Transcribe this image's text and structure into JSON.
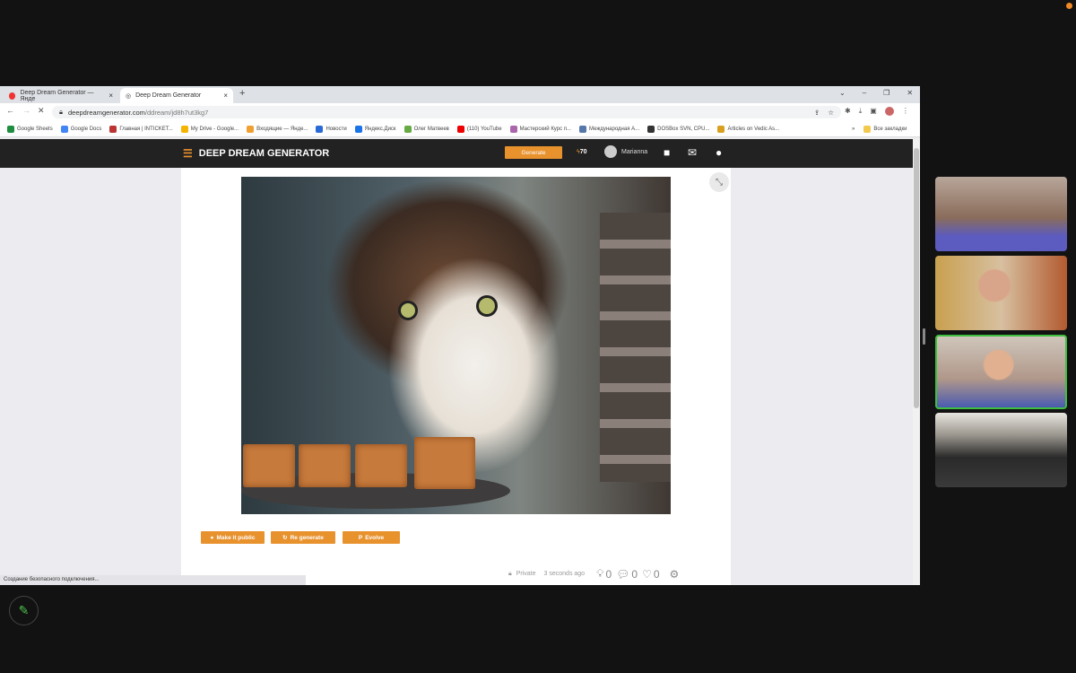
{
  "browser": {
    "tabs": [
      {
        "label": "Deep Dream Generator — Янде"
      },
      {
        "label": "Deep Dream Generator",
        "active": true
      }
    ],
    "url_domain": "deepdreamgenerator.com",
    "url_path": "/ddream/jd8h7ut3kg7",
    "bookmarks": [
      {
        "label": "Google Sheets",
        "color": "#1e8e3e"
      },
      {
        "label": "Google Docs",
        "color": "#4285f4"
      },
      {
        "label": "Главная | INTICKET...",
        "color": "#b33"
      },
      {
        "label": "My Drive - Google...",
        "color": "#f4b400"
      },
      {
        "label": "Входящие — Янде...",
        "color": "#f0a030"
      },
      {
        "label": "Новости",
        "color": "#2a6ad8"
      },
      {
        "label": "Яндекс.Диск",
        "color": "#1a73e8"
      },
      {
        "label": "Олег Матвеев",
        "color": "#6a4"
      },
      {
        "label": "(110) YouTube",
        "color": "#e00"
      },
      {
        "label": "Мастерский Курс п...",
        "color": "#a6a"
      },
      {
        "label": "Международная А...",
        "color": "#57a"
      },
      {
        "label": "DOSBox SVN, CPU...",
        "color": "#333"
      },
      {
        "label": "Articles on Vedic As...",
        "color": "#d9a020"
      }
    ],
    "more_bookmarks": "»",
    "all_bookmarks": "Все закладки",
    "status_text": "Создание безопасного подключения..."
  },
  "site": {
    "logo": "DEEP DREAM GENERATOR",
    "generate_label": "Generate",
    "credits": "70",
    "username": "Marianna",
    "accent": "#e8922e",
    "actions": [
      {
        "label": "Make it public",
        "icon": "globe-icon"
      },
      {
        "label": "Re generate",
        "icon": "refresh-icon"
      },
      {
        "label": "Evolve",
        "icon": "evolve-icon"
      }
    ],
    "privacy": "Private",
    "time": "3 seconds ago",
    "ideas": "0",
    "comments": "0",
    "likes": "0"
  },
  "call": {
    "participants": 4,
    "active_speaker": 3
  }
}
